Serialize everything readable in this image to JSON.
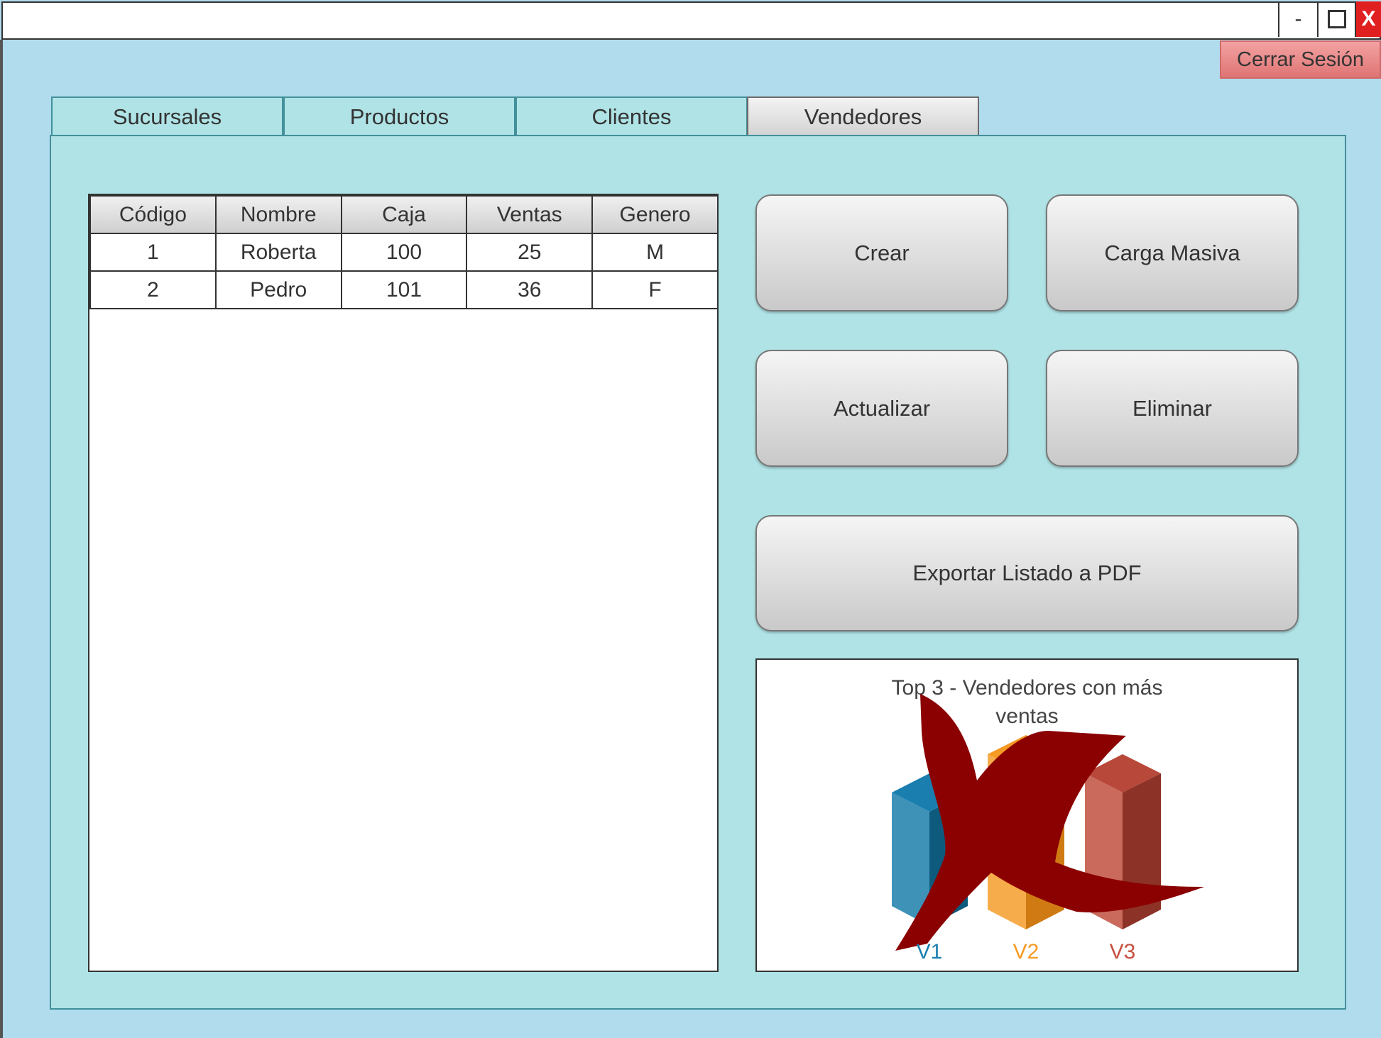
{
  "window": {
    "minimize_label": "-",
    "close_label": "X"
  },
  "header": {
    "logout_label": "Cerrar Sesión"
  },
  "tabs": [
    {
      "label": "Sucursales",
      "active": false
    },
    {
      "label": "Productos",
      "active": false
    },
    {
      "label": "Clientes",
      "active": false
    },
    {
      "label": "Vendedores",
      "active": true
    }
  ],
  "table": {
    "columns": [
      "Código",
      "Nombre",
      "Caja",
      "Ventas",
      "Genero"
    ],
    "rows": [
      [
        "1",
        "Roberta",
        "100",
        "25",
        "M"
      ],
      [
        "2",
        "Pedro",
        "101",
        "36",
        "F"
      ]
    ]
  },
  "actions": {
    "create_label": "Crear",
    "bulk_load_label": "Carga Masiva",
    "update_label": "Actualizar",
    "delete_label": "Eliminar",
    "export_label": "Exportar Listado a PDF"
  },
  "chart": {
    "title_line1": "Top 3 - Vendedores con más",
    "title_line2": "ventas",
    "bars": [
      {
        "label": "V1",
        "color": "#1a7fae"
      },
      {
        "label": "V2",
        "color": "#f5a033"
      },
      {
        "label": "V3",
        "color": "#c8503f"
      }
    ],
    "placeholder_icon": "broken-image-x-icon",
    "placeholder_color": "#8b0000"
  }
}
